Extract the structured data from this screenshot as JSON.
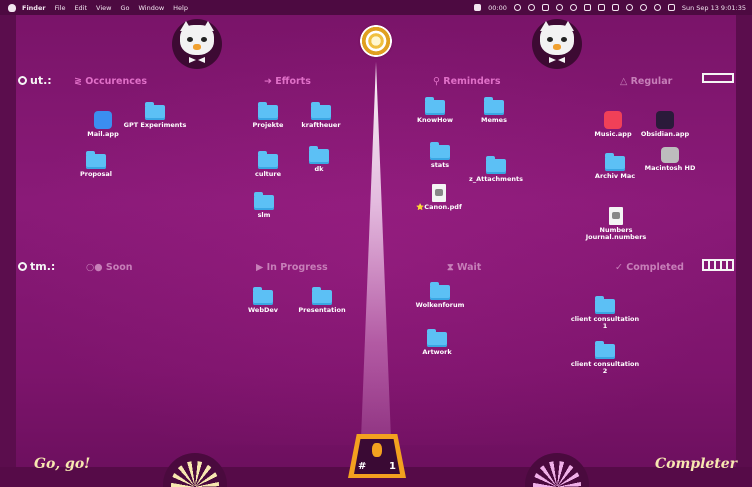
{
  "menubar": {
    "app": "Finder",
    "items": [
      "File",
      "Edit",
      "View",
      "Go",
      "Window",
      "Help"
    ],
    "timer": "00:00",
    "datetime": "Sun Sep 13  9:01:35"
  },
  "rows": {
    "top": {
      "label": "ut.:"
    },
    "bottom": {
      "label": "tm.:"
    }
  },
  "columns_top": [
    "≷ Occurences",
    "➜ Efforts",
    "⚲ Reminders",
    "△ Regular"
  ],
  "columns_bottom": [
    "○● Soon",
    "▶ In Progress",
    "⧗ Wait",
    "✓ Completed"
  ],
  "items": {
    "mail": "Mail.app",
    "gpt": "GPT Experiments",
    "proposal": "Proposal",
    "projekte": "Projekte",
    "kraftheuer": "kraftheuer",
    "culture": "culture",
    "dk": "dk",
    "slm": "slm",
    "knowhow": "KnowHow",
    "memes": "Memes",
    "stats": "stats",
    "attachments": "z_Attachments",
    "canon": "⭐Canon.pdf",
    "music": "Music.app",
    "obsidian": "Obsidian.app",
    "archiv": "Archiv Mac",
    "macintosh": "Macintosh HD",
    "numbers": "Numbers Journal.numbers",
    "webdev": "WebDev",
    "presentation": "Presentation",
    "wolkenforum": "Wolkenforum",
    "artwork": "Artwork",
    "client1": "client consultation 1",
    "client2": "client consultation 2"
  },
  "badge": {
    "left": "#",
    "right": "1"
  },
  "footer": {
    "left": "Go, go!",
    "right": "Completer"
  },
  "colors": {
    "folder": "#5cc0f5",
    "label": "#e070c8",
    "accent": "#f3a11f"
  }
}
